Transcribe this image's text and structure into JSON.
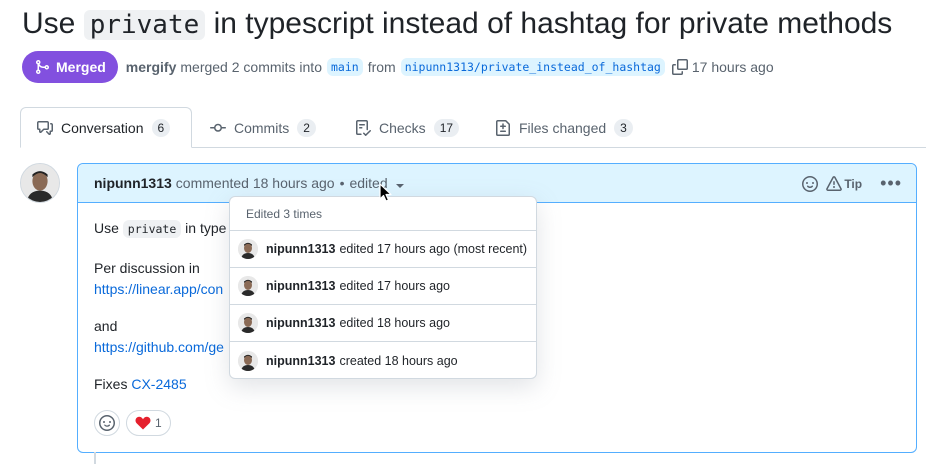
{
  "pr": {
    "title_before": "Use ",
    "title_code": "private",
    "title_after": " in typescript instead of hashtag for private methods",
    "status_label": "Merged",
    "merger": "mergify",
    "merge_text_1": "merged 2 commits into",
    "base_branch": "main",
    "merge_text_2": "from",
    "head_branch": "nipunn1313/private_instead_of_hashtag",
    "merge_time": "17 hours ago"
  },
  "tabs": [
    {
      "label": "Conversation",
      "count": "6",
      "icon": "comment-discussion-icon"
    },
    {
      "label": "Commits",
      "count": "2",
      "icon": "git-commit-icon"
    },
    {
      "label": "Checks",
      "count": "17",
      "icon": "checklist-icon"
    },
    {
      "label": "Files changed",
      "count": "3",
      "icon": "file-diff-icon"
    }
  ],
  "comment": {
    "author": "nipunn1313",
    "action": "commented 18 hours ago",
    "separator": "•",
    "edited_label": "edited",
    "tip_label": "Tip",
    "kebab": "•••",
    "body": {
      "line1_prefix": "Use ",
      "line1_code": "private",
      "line1_suffix": " in type",
      "line2": "Per discussion in",
      "line3_link": "https://linear.app/con",
      "line4": "and",
      "line5_link": "https://github.com/ge",
      "line6_prefix": "Fixes ",
      "line6_link": "CX-2485"
    },
    "reaction_heart_count": "1"
  },
  "edit_history": {
    "header": "Edited 3 times",
    "items": [
      {
        "author": "nipunn1313",
        "text": "edited 17 hours ago (most recent)"
      },
      {
        "author": "nipunn1313",
        "text": "edited 17 hours ago"
      },
      {
        "author": "nipunn1313",
        "text": "edited 18 hours ago"
      },
      {
        "author": "nipunn1313",
        "text": "created 18 hours ago"
      }
    ]
  },
  "colors": {
    "merged_purple": "#8250df",
    "link_blue": "#0969da",
    "header_bg": "#ddf4ff",
    "border_blue": "#54aeff"
  }
}
